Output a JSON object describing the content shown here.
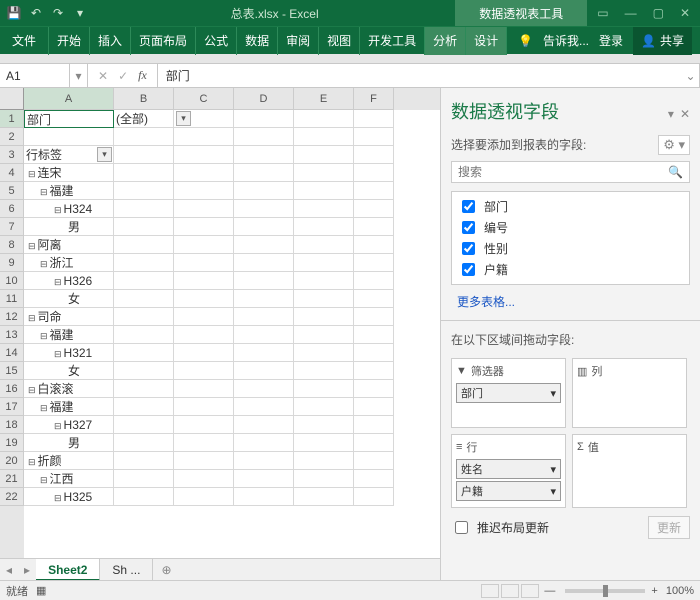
{
  "title": "总表.xlsx - Excel",
  "contextual_tab": "数据透视表工具",
  "qat": [
    "save-icon",
    "undo-icon",
    "redo-icon",
    "touch-icon"
  ],
  "ribbon": {
    "file": "文件",
    "tabs": [
      "开始",
      "插入",
      "页面布局",
      "公式",
      "数据",
      "审阅",
      "视图",
      "开发工具"
    ],
    "ctx": [
      "分析",
      "设计"
    ],
    "tell_me": "告诉我...",
    "signin": "登录",
    "share": "共享"
  },
  "namebox": "A1",
  "fx_label": "fx",
  "formula": "部门",
  "columns": [
    "A",
    "B",
    "C",
    "D",
    "E",
    "F"
  ],
  "rows": [
    {
      "n": 1,
      "A": "部门",
      "B": "(全部)",
      "dd": true
    },
    {
      "n": 2
    },
    {
      "n": 3,
      "A": "行标签",
      "ddA": true
    },
    {
      "n": 4,
      "A": "连宋",
      "lvl": 1,
      "c": true
    },
    {
      "n": 5,
      "A": "福建",
      "lvl": 2,
      "c": true
    },
    {
      "n": 6,
      "A": "H324",
      "lvl": 3,
      "c": true
    },
    {
      "n": 7,
      "A": "男",
      "lvl": 4
    },
    {
      "n": 8,
      "A": "阿离",
      "lvl": 1,
      "c": true
    },
    {
      "n": 9,
      "A": "浙江",
      "lvl": 2,
      "c": true
    },
    {
      "n": 10,
      "A": "H326",
      "lvl": 3,
      "c": true
    },
    {
      "n": 11,
      "A": "女",
      "lvl": 4
    },
    {
      "n": 12,
      "A": "司命",
      "lvl": 1,
      "c": true
    },
    {
      "n": 13,
      "A": "福建",
      "lvl": 2,
      "c": true
    },
    {
      "n": 14,
      "A": "H321",
      "lvl": 3,
      "c": true
    },
    {
      "n": 15,
      "A": "女",
      "lvl": 4
    },
    {
      "n": 16,
      "A": "白滚滚",
      "lvl": 1,
      "c": true
    },
    {
      "n": 17,
      "A": "福建",
      "lvl": 2,
      "c": true
    },
    {
      "n": 18,
      "A": "H327",
      "lvl": 3,
      "c": true
    },
    {
      "n": 19,
      "A": "男",
      "lvl": 4
    },
    {
      "n": 20,
      "A": "折颜",
      "lvl": 1,
      "c": true
    },
    {
      "n": 21,
      "A": "江西",
      "lvl": 2,
      "c": true
    },
    {
      "n": 22,
      "A": "H325",
      "lvl": 3,
      "c": true
    }
  ],
  "sheets": {
    "active": "Sheet2",
    "others": [
      "Sh ..."
    ]
  },
  "status": {
    "ready": "就绪",
    "zoom": "100%"
  },
  "pane": {
    "title": "数据透视字段",
    "choose": "选择要添加到报表的字段:",
    "search_ph": "搜索",
    "fields": [
      {
        "l": "部门",
        "c": true
      },
      {
        "l": "编号",
        "c": true
      },
      {
        "l": "性别",
        "c": true
      },
      {
        "l": "户籍",
        "c": true
      }
    ],
    "more": "更多表格...",
    "drag": "在以下区域间拖动字段:",
    "filters": {
      "t": "筛选器",
      "items": [
        "部门"
      ]
    },
    "cols": {
      "t": "列"
    },
    "rowsA": {
      "t": "行",
      "items": [
        "姓名",
        "户籍"
      ]
    },
    "vals": {
      "t": "值"
    },
    "defer": "推迟布局更新",
    "update": "更新"
  }
}
